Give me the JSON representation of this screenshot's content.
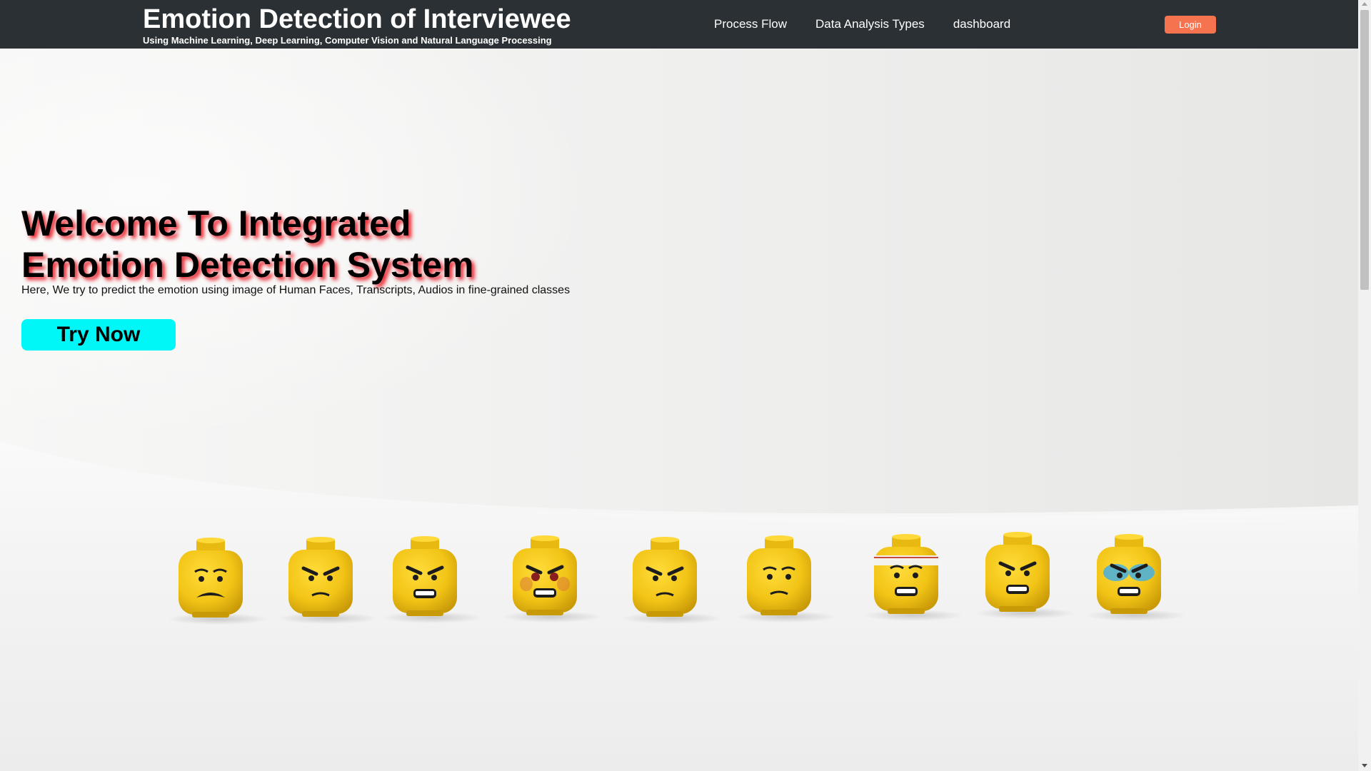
{
  "navbar": {
    "title": "Emotion Detection of Interviewee",
    "subtitle": "Using Machine Learning, Deep Learning, Computer Vision and Natural Language Processing",
    "links": [
      {
        "label": "Process Flow"
      },
      {
        "label": "Data Analysis Types"
      },
      {
        "label": "dashboard"
      }
    ],
    "login_label": "Login"
  },
  "hero": {
    "heading_line1": "Welcome To Integrated",
    "heading_line2": "Emotion Detection System",
    "description": "Here, We try to predict the emotion using image of Human Faces, Transcripts, Audios in fine-grained classes",
    "cta_label": "Try Now",
    "image_subject": "row of nine yellow minifigure heads with different facial expressions"
  },
  "colors": {
    "navbar_bg": "#2a3033",
    "login_bg": "#f6734f",
    "cta_bg": "#00f7f7",
    "heading_shadow": "#e8202a",
    "head_yellow": "#f2c416"
  },
  "icons": [
    "scroll-up-arrow-icon",
    "scroll-down-arrow-icon"
  ]
}
